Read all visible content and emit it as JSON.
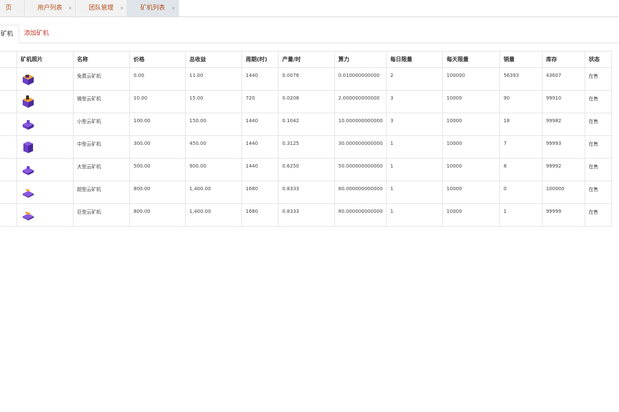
{
  "tabs": [
    {
      "label": "页",
      "active": false,
      "closable": false
    },
    {
      "label": "用户列表",
      "active": false,
      "closable": true
    },
    {
      "label": "团队管理",
      "active": false,
      "closable": true
    },
    {
      "label": "矿机列表",
      "active": true,
      "closable": true
    }
  ],
  "close_glyph": "×",
  "subtabs": {
    "current": "矿机",
    "add": "添加矿机"
  },
  "table": {
    "headers": [
      "",
      "矿机照片",
      "名称",
      "价格",
      "总收益",
      "周期(时)",
      "产量/时",
      "算力",
      "每日限量",
      "每天限量",
      "销量",
      "库存",
      "状态"
    ],
    "rows": [
      {
        "name": "免费云矿机",
        "price": "0.00",
        "total": "11.00",
        "cycle": "1440",
        "rate": "0.0076",
        "power": "0.010000000000",
        "daily": "2",
        "limit": "100000",
        "sold": "56393",
        "stock": "43607",
        "status": "在售",
        "image": "free-miner-icon"
      },
      {
        "name": "微型云矿机",
        "price": "10.00",
        "total": "15.00",
        "cycle": "720",
        "rate": "0.0208",
        "power": "2.000000000000",
        "daily": "3",
        "limit": "10000",
        "sold": "90",
        "stock": "99910",
        "status": "在售",
        "image": "micro-miner-icon"
      },
      {
        "name": "小型云矿机",
        "price": "100.00",
        "total": "150.00",
        "cycle": "1440",
        "rate": "0.1042",
        "power": "10.000000000000",
        "daily": "3",
        "limit": "10000",
        "sold": "18",
        "stock": "99982",
        "status": "在售",
        "image": "small-miner-icon"
      },
      {
        "name": "中型云矿机",
        "price": "300.00",
        "total": "450.00",
        "cycle": "1440",
        "rate": "0.3125",
        "power": "30.000000000000",
        "daily": "1",
        "limit": "10000",
        "sold": "7",
        "stock": "99993",
        "status": "在售",
        "image": "medium-miner-icon"
      },
      {
        "name": "大型云矿机",
        "price": "500.00",
        "total": "900.00",
        "cycle": "1440",
        "rate": "0.6250",
        "power": "50.000000000000",
        "daily": "1",
        "limit": "10000",
        "sold": "8",
        "stock": "99992",
        "status": "在售",
        "image": "large-miner-icon"
      },
      {
        "name": "超型云矿机",
        "price": "800.00",
        "total": "1,400.00",
        "cycle": "1680",
        "rate": "0.8333",
        "power": "80.000000000000",
        "daily": "1",
        "limit": "10000",
        "sold": "0",
        "stock": "100000",
        "status": "在售",
        "image": "super-miner-icon"
      },
      {
        "name": "巨型云矿机",
        "price": "800.00",
        "total": "1,400.00",
        "cycle": "1680",
        "rate": "0.8333",
        "power": "80.000000000000",
        "daily": "1",
        "limit": "10000",
        "sold": "1",
        "stock": "99999",
        "status": "在售",
        "image": "giant-miner-icon"
      }
    ]
  },
  "colors": {
    "accent": "#b5531f",
    "link_red": "#c0392b",
    "icon_purple": "#6a3fc8",
    "icon_orange": "#f0a030"
  }
}
